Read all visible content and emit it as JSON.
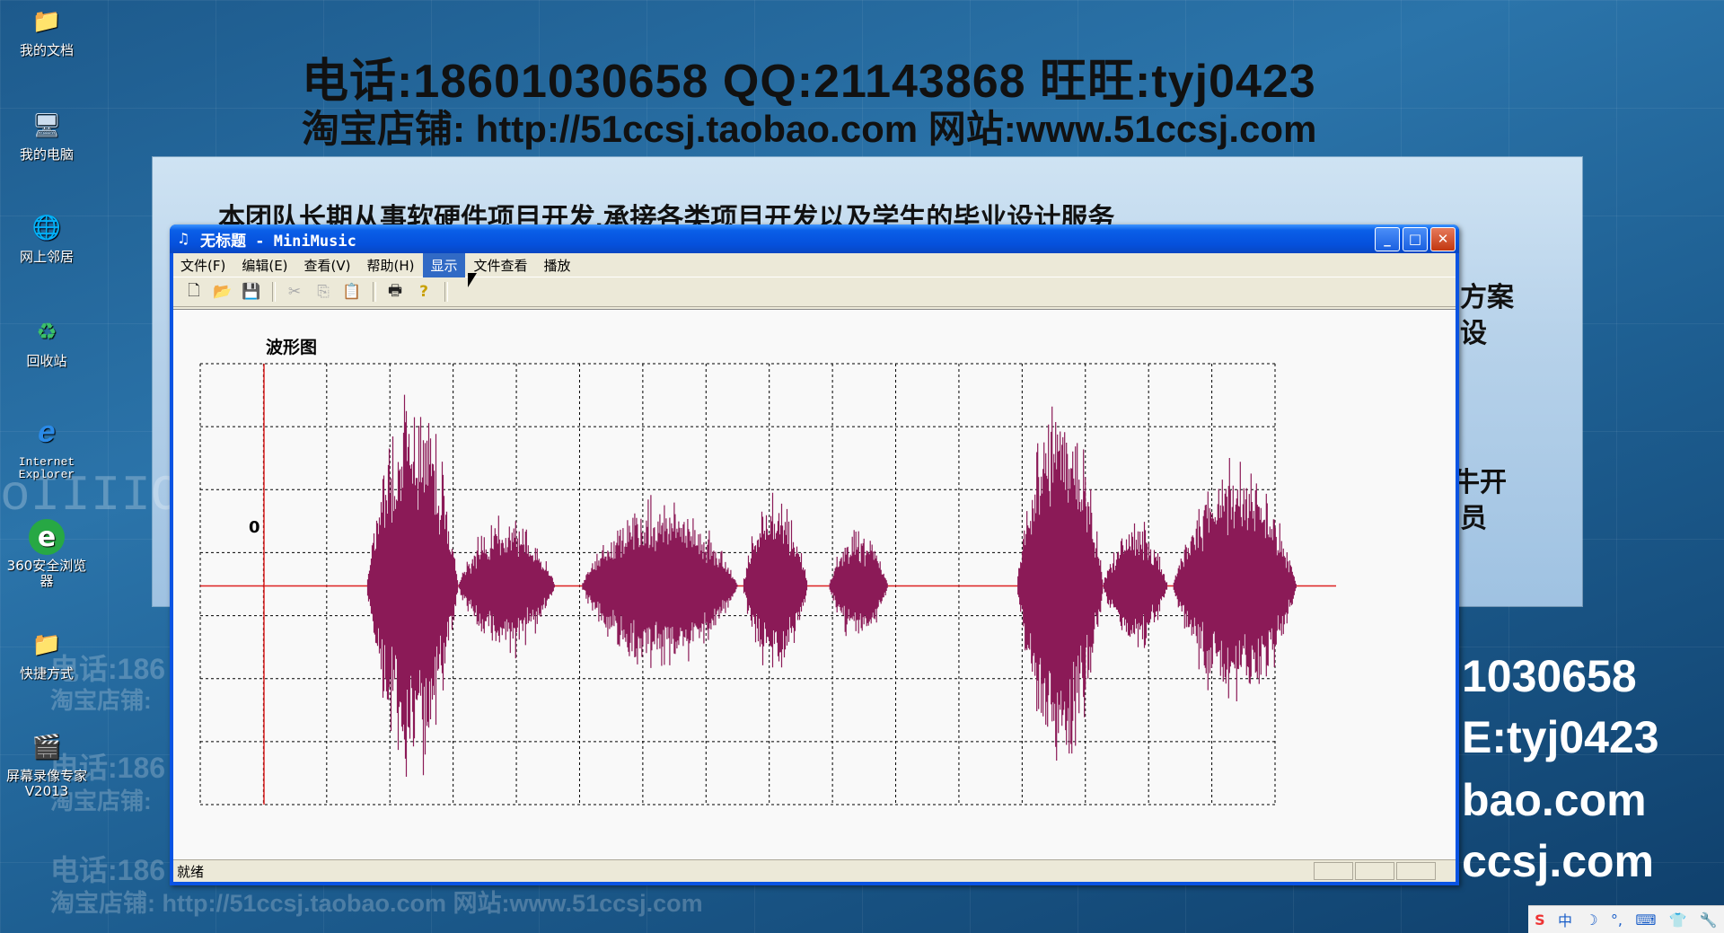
{
  "desktop": {
    "banner": {
      "line1": "电话:18601030658    QQ:21143868    旺旺:tyj0423",
      "line2": "淘宝店铺: http://51ccsj.taobao.com    网站:www.51ccsj.com",
      "panel_text": "本团队长期从事软硬件项目开发,承接各类项目开发以及学生的毕业设计服务",
      "right_partials": [
        "方案",
        "设",
        "牛开",
        "员"
      ],
      "big_right": [
        "1030658",
        "E:tyj0423",
        "bao.com",
        "ccsj.com"
      ],
      "ghost": [
        "电话:186",
        "淘宝店铺:",
        "电话:186",
        "淘宝店铺:",
        "电话:186",
        "淘宝店铺: http://51ccsj.taobao.com    网站:www.51ccsj.com"
      ],
      "binary": "oIIIIOIOC"
    },
    "icons": [
      {
        "label": "我的文档",
        "glyph": "📁"
      },
      {
        "label": "我的电脑",
        "glyph": "🖥"
      },
      {
        "label": "网上邻居",
        "glyph": "🌐"
      },
      {
        "label": "回收站",
        "glyph": "♻"
      },
      {
        "label": "Internet Explorer",
        "glyph": "e"
      },
      {
        "label": "360安全浏览器",
        "glyph": "e"
      },
      {
        "label": "快捷方式",
        "glyph": "📁"
      },
      {
        "label": "屏幕录像专家V2013",
        "glyph": "🎬"
      }
    ]
  },
  "window": {
    "title": "无标题 - MiniMusic",
    "menu": [
      "文件(F)",
      "编辑(E)",
      "查看(V)",
      "帮助(H)",
      "显示",
      "文件查看",
      "播放"
    ],
    "active_menu": "显示",
    "toolbar": {
      "new": "new-file-icon",
      "open": "open-folder-icon",
      "save": "save-icon",
      "cut": "cut-icon",
      "copy": "copy-icon",
      "paste": "paste-icon",
      "print": "print-icon",
      "help": "help-icon"
    },
    "status": "就绪"
  },
  "chart_data": {
    "type": "line",
    "title": "波形图",
    "zero_label": "0",
    "grid": true,
    "grid_cols": 17,
    "grid_rows": 7,
    "wave_color": "#8b1a57",
    "axis_color": "#dd2222",
    "segments": [
      {
        "start": 0.155,
        "end": 0.24,
        "amp": 1.0
      },
      {
        "start": 0.24,
        "end": 0.33,
        "amp": 0.35
      },
      {
        "start": 0.355,
        "end": 0.5,
        "amp": 0.45
      },
      {
        "start": 0.505,
        "end": 0.565,
        "amp": 0.48
      },
      {
        "start": 0.585,
        "end": 0.64,
        "amp": 0.28
      },
      {
        "start": 0.76,
        "end": 0.84,
        "amp": 0.95
      },
      {
        "start": 0.84,
        "end": 0.9,
        "amp": 0.32
      },
      {
        "start": 0.905,
        "end": 1.02,
        "amp": 0.62
      }
    ]
  },
  "tray": {
    "items": [
      "S",
      "中",
      "☽",
      "°,",
      "⌨",
      "👕",
      "🔧"
    ]
  }
}
